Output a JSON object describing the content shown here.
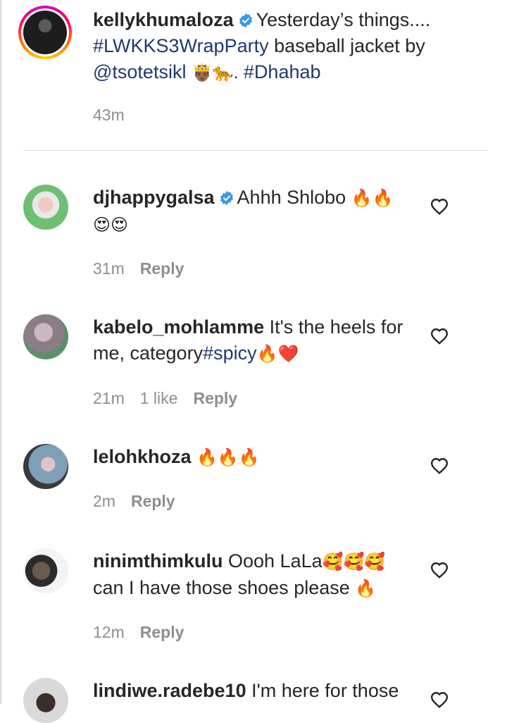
{
  "post": {
    "username": "kellykhumaloza",
    "caption_text": "Yesterday’s things....",
    "hashtag1": "#LWKKS3WrapParty",
    "caption_mid": " baseball jacket by",
    "mention": "@tsotetsikl",
    "emojis": "🤴🏾🐆.",
    "hashtag2": "#Dhahab",
    "time": "43m"
  },
  "comments": [
    {
      "username": "djhappygalsa",
      "text": "Ahhh Shlobo",
      "emojis_inline": "🔥🔥",
      "emojis_line2": "😍😍",
      "time": "31m",
      "reply": "Reply"
    },
    {
      "username": "kabelo_mohlamme",
      "text1": "It's the heels for",
      "text2": "me, category",
      "hashtag": "#spicy",
      "emojis": "🔥❤️",
      "time": "21m",
      "likes": "1 like",
      "reply": "Reply"
    },
    {
      "username": "lelohkhoza",
      "emojis": "🔥🔥🔥",
      "time": "2m",
      "reply": "Reply"
    },
    {
      "username": "ninimthimkulu",
      "text1": "Oooh LaLa",
      "emojis1": "🥰🥰🥰",
      "text2": "can I have those shoes please ",
      "emojis2": "🔥",
      "time": "12m",
      "reply": "Reply"
    },
    {
      "username": "lindiwe.radebe10",
      "text": "I'm here for those"
    }
  ],
  "colors": {
    "text": "#262626",
    "secondary": "#8e8e8e",
    "hashtag": "#1e3a6e",
    "verified": "#3897f0"
  },
  "icons": {
    "verified": "verified-badge-icon",
    "like": "heart-outline-icon"
  }
}
